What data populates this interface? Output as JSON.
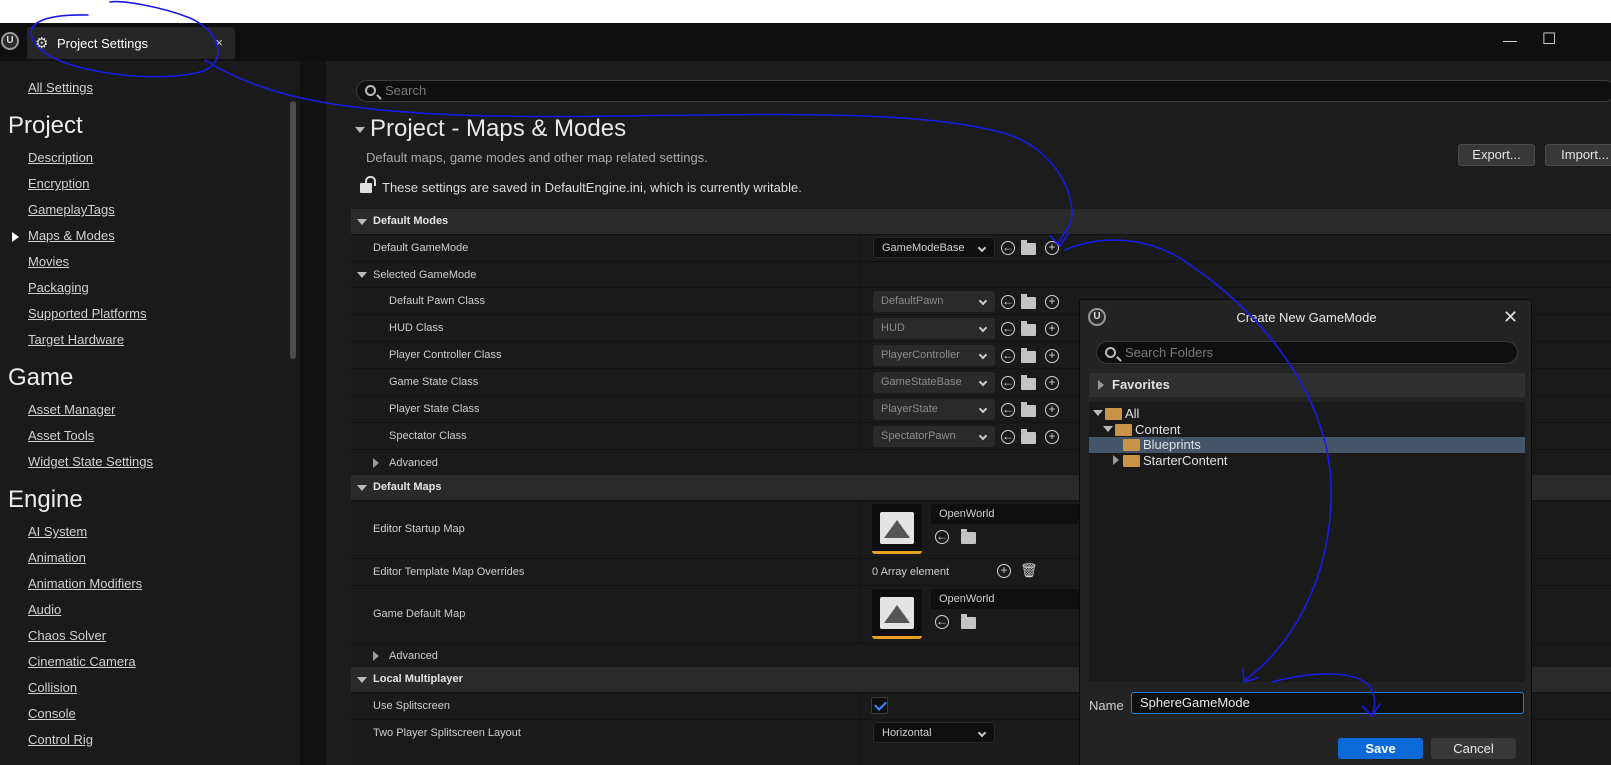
{
  "tab": {
    "title": "Project Settings",
    "close": "×"
  },
  "window": {
    "minimize": "—",
    "maximize": "☐"
  },
  "sidebar": {
    "all_settings": "All Settings",
    "sections": [
      {
        "heading": "Project",
        "items": [
          "Description",
          "Encryption",
          "GameplayTags",
          "Maps & Modes",
          "Movies",
          "Packaging",
          "Supported Platforms",
          "Target Hardware"
        ]
      },
      {
        "heading": "Game",
        "items": [
          "Asset Manager",
          "Asset Tools",
          "Widget State Settings"
        ]
      },
      {
        "heading": "Engine",
        "items": [
          "AI System",
          "Animation",
          "Animation Modifiers",
          "Audio",
          "Chaos Solver",
          "Cinematic Camera",
          "Collision",
          "Console",
          "Control Rig"
        ]
      }
    ],
    "selected_item": "Maps & Modes"
  },
  "search": {
    "placeholder": "Search"
  },
  "page": {
    "title": "Project - Maps & Modes",
    "subtitle": "Default maps, game modes and other map related settings.",
    "writable_notice": "These settings are saved in DefaultEngine.ini, which is currently writable.",
    "export_label": "Export...",
    "import_label": "Import..."
  },
  "default_modes": {
    "heading": "Default Modes",
    "default_gamemode_label": "Default GameMode",
    "default_gamemode_value": "GameModeBase",
    "selected_gamemode_heading": "Selected GameMode",
    "classes": [
      {
        "label": "Default Pawn Class",
        "value": "DefaultPawn"
      },
      {
        "label": "HUD Class",
        "value": "HUD"
      },
      {
        "label": "Player Controller Class",
        "value": "PlayerController"
      },
      {
        "label": "Game State Class",
        "value": "GameStateBase"
      },
      {
        "label": "Player State Class",
        "value": "PlayerState"
      },
      {
        "label": "Spectator Class",
        "value": "SpectatorPawn"
      }
    ],
    "advanced_label": "Advanced"
  },
  "default_maps": {
    "heading": "Default Maps",
    "editor_startup_map_label": "Editor Startup Map",
    "editor_startup_map_value": "OpenWorld",
    "template_overrides_label": "Editor Template Map Overrides",
    "template_overrides_value": "0 Array element",
    "game_default_map_label": "Game Default Map",
    "game_default_map_value": "OpenWorld",
    "advanced_label": "Advanced"
  },
  "local_multiplayer": {
    "heading": "Local Multiplayer",
    "use_splitscreen_label": "Use Splitscreen",
    "use_splitscreen_checked": true,
    "two_player_layout_label": "Two Player Splitscreen Layout",
    "two_player_layout_value": "Horizontal"
  },
  "dialog": {
    "title": "Create New GameMode",
    "search_placeholder": "Search Folders",
    "favorites_label": "Favorites",
    "tree": [
      "All",
      "Content",
      "Blueprints",
      "StarterContent"
    ],
    "selected_folder": "Blueprints",
    "name_label": "Name",
    "name_value": "SphereGameMode",
    "save_label": "Save",
    "cancel_label": "Cancel"
  },
  "colors": {
    "accent": "#0b6ad8",
    "folder": "#c89548",
    "annotation_ink": "#1a1ae6",
    "selection": "#44556a"
  },
  "icons": [
    "unreal-logo-icon",
    "gear-icon",
    "close-icon",
    "search-icon",
    "lock-open-icon",
    "chevron-down-icon",
    "browse-arrow-icon",
    "browse-folder-icon",
    "add-circle-icon",
    "trash-icon",
    "map-thumbnail-icon",
    "folder-icon",
    "check-icon"
  ]
}
